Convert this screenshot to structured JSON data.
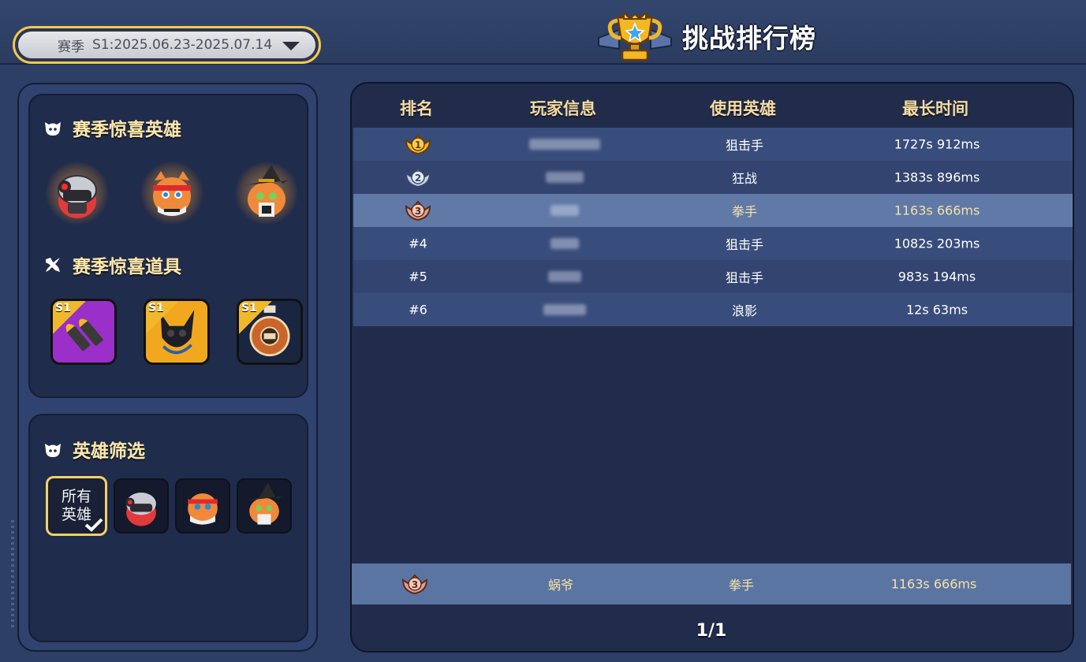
{
  "season_select": {
    "label": "赛季",
    "value": "S1:2025.06.23-2025.07.14"
  },
  "page_title": "挑战排行榜",
  "left": {
    "surprise_heroes_title": "赛季惊喜英雄",
    "surprise_items_title": "赛季惊喜道具",
    "item_tag": "S1",
    "hero_filter_title": "英雄筛选",
    "filter_all_label": "所有\n英雄"
  },
  "table": {
    "headers": {
      "rank": "排名",
      "player": "玩家信息",
      "hero": "使用英雄",
      "time": "最长时间"
    },
    "rows": [
      {
        "rank": "1",
        "hero": "狙击手",
        "time": "1727s  912ms"
      },
      {
        "rank": "2",
        "hero": "狂战",
        "time": "1383s  896ms"
      },
      {
        "rank": "3",
        "hero": "拳手",
        "time": "1163s  666ms"
      },
      {
        "rank": "#4",
        "hero": "狙击手",
        "time": "1082s  203ms"
      },
      {
        "rank": "#5",
        "hero": "狙击手",
        "time": "983s  194ms"
      },
      {
        "rank": "#6",
        "hero": "浪影",
        "time": "12s  63ms"
      }
    ],
    "my_row": {
      "rank": "3",
      "player": "蜗爷",
      "hero": "拳手",
      "time": "1163s  666ms"
    }
  },
  "pager": "1/1",
  "colors": {
    "gold": "#f3c84a",
    "header_text": "#f5dba0",
    "highlight_text": "#f6e2a4"
  }
}
